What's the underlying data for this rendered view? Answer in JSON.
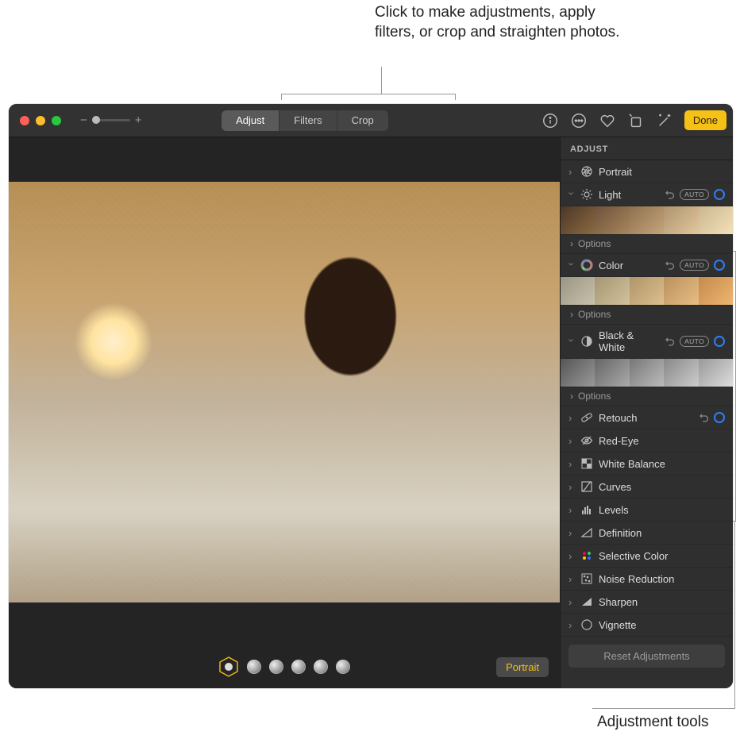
{
  "callouts": {
    "top": "Click to make adjustments, apply filters, or crop and straighten photos.",
    "bottom": "Adjustment tools"
  },
  "toolbar": {
    "zoom_minus": "−",
    "zoom_plus": "+",
    "segments": {
      "adjust": "Adjust",
      "filters": "Filters",
      "crop": "Crop"
    },
    "done": "Done"
  },
  "lighting": {
    "portrait_label": "Portrait"
  },
  "sidebar": {
    "header": "ADJUST",
    "portrait": "Portrait",
    "light": "Light",
    "color": "Color",
    "bw": "Black & White",
    "retouch": "Retouch",
    "redeye": "Red-Eye",
    "wb": "White Balance",
    "curves": "Curves",
    "levels": "Levels",
    "definition": "Definition",
    "selcolor": "Selective Color",
    "noise": "Noise Reduction",
    "sharpen": "Sharpen",
    "vignette": "Vignette",
    "options": "Options",
    "auto": "AUTO",
    "reset": "Reset Adjustments"
  }
}
